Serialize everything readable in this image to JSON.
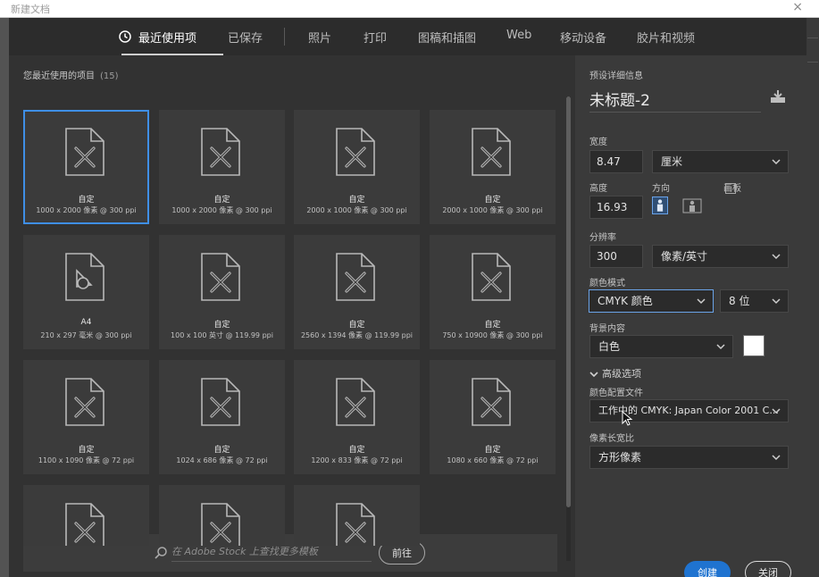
{
  "window": {
    "title": "新建文档",
    "close_glyph": "×"
  },
  "tabs": [
    {
      "label": "最近使用项",
      "active": true,
      "icon": "clock-icon"
    },
    {
      "label": "已保存",
      "active": false
    },
    {
      "label": "照片",
      "active": false
    },
    {
      "label": "打印",
      "active": false
    },
    {
      "label": "图稿和插图",
      "active": false
    },
    {
      "label": "Web",
      "active": false
    },
    {
      "label": "移动设备",
      "active": false
    },
    {
      "label": "胶片和视频",
      "active": false
    }
  ],
  "recent": {
    "title": "您最近使用的项目",
    "count": "(15)",
    "items": [
      {
        "name": "自定",
        "size": "1000 x 2000 像素 @ 300 ppi",
        "icon": "custom-doc-icon",
        "selected": true
      },
      {
        "name": "自定",
        "size": "1000 x 2000 像素 @ 300 ppi",
        "icon": "custom-doc-icon"
      },
      {
        "name": "自定",
        "size": "2000 x 1000 像素 @ 300 ppi",
        "icon": "custom-doc-icon"
      },
      {
        "name": "自定",
        "size": "2000 x 1000 像素 @ 300 ppi",
        "icon": "custom-doc-icon"
      },
      {
        "name": "A4",
        "size": "210 x 297 毫米 @ 300 ppi",
        "icon": "print-doc-icon"
      },
      {
        "name": "自定",
        "size": "100 x 100 英寸 @ 119.99 ppi",
        "icon": "custom-doc-icon"
      },
      {
        "name": "自定",
        "size": "2560 x 1394 像素 @ 119.99 ppi",
        "icon": "custom-doc-icon"
      },
      {
        "name": "自定",
        "size": "750 x 10900 像素 @ 300 ppi",
        "icon": "custom-doc-icon"
      },
      {
        "name": "自定",
        "size": "1100 x 1090 像素 @ 72 ppi",
        "icon": "custom-doc-icon"
      },
      {
        "name": "自定",
        "size": "1024 x 686 像素 @ 72 ppi",
        "icon": "custom-doc-icon"
      },
      {
        "name": "自定",
        "size": "1200 x 833 像素 @ 72 ppi",
        "icon": "custom-doc-icon"
      },
      {
        "name": "自定",
        "size": "1080 x 660 像素 @ 72 ppi",
        "icon": "custom-doc-icon"
      },
      {
        "name": "",
        "size": "",
        "icon": "custom-doc-icon"
      },
      {
        "name": "",
        "size": "",
        "icon": "custom-doc-icon"
      },
      {
        "name": "",
        "size": "",
        "icon": "custom-doc-icon"
      }
    ]
  },
  "stock": {
    "placeholder": "在 Adobe Stock 上查找更多模板",
    "go_label": "前往"
  },
  "preset": {
    "header": "预设详细信息",
    "doc_name": "未标题-2",
    "width_label": "宽度",
    "width_value": "8.47",
    "width_unit": "厘米",
    "height_label": "高度",
    "height_value": "16.93",
    "orientation_label": "方向",
    "artboard_label": "画板",
    "resolution_label": "分辨率",
    "resolution_value": "300",
    "resolution_unit": "像素/英寸",
    "color_mode_label": "颜色模式",
    "color_mode": "CMYK 颜色",
    "bit_depth": "8 位",
    "background_label": "背景内容",
    "background": "白色",
    "background_color": "#ffffff",
    "advanced_label": "高级选项",
    "color_profile_label": "颜色配置文件",
    "color_profile": "工作中的 CMYK: Japan Color 2001 C...",
    "pixel_aspect_label": "像素长宽比",
    "pixel_aspect": "方形像素"
  },
  "actions": {
    "create": "创建",
    "close": "关闭"
  },
  "colors": {
    "accent": "#1f73d0",
    "selection": "#3f8fe6"
  }
}
